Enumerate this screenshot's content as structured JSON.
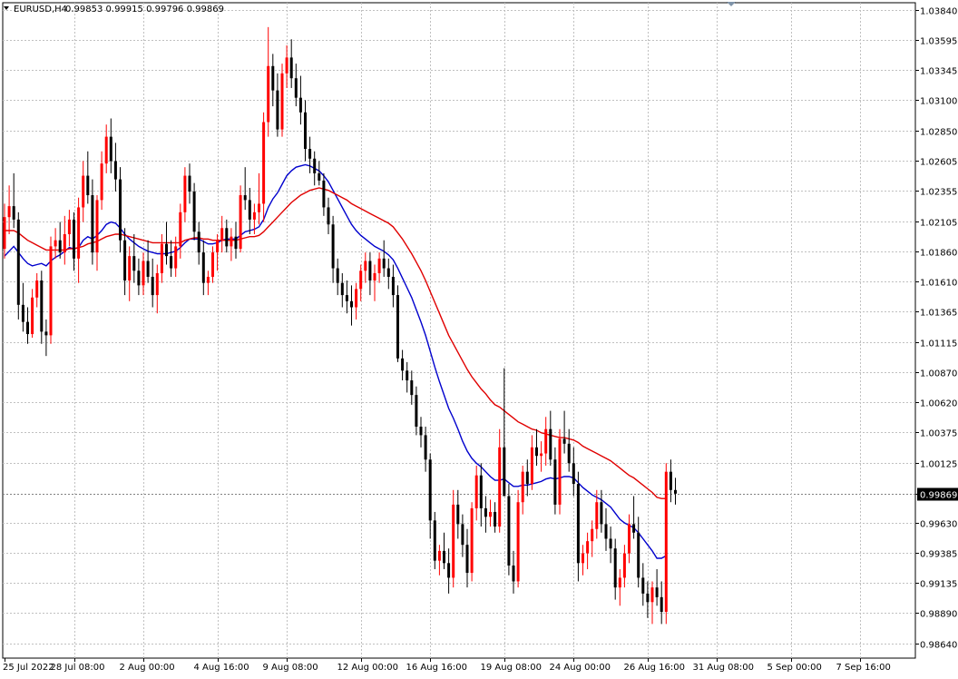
{
  "header": {
    "symbol_tf": "EURUSD,H4",
    "ohlc": "0.99853 0.99915 0.99796 0.99869"
  },
  "colors": {
    "background": "#ffffff",
    "grid": "#c0c0c0",
    "bull": "#ff0000",
    "bear": "#000000",
    "ma_fast": "#0000cd",
    "ma_slow": "#e00000",
    "price_tag_bg": "#000000",
    "price_tag_text": "#ffffff"
  },
  "chart_data": {
    "type": "candlestick",
    "title": "EURUSD,H4",
    "grid": true,
    "ylim": [
      0.9852,
      1.039
    ],
    "y_ticks": [
      "1.03840",
      "1.03595",
      "1.03345",
      "1.03100",
      "1.02850",
      "1.02605",
      "1.02355",
      "1.02105",
      "1.01860",
      "1.01610",
      "1.01365",
      "1.01115",
      "1.00870",
      "1.00620",
      "1.00375",
      "1.00125",
      "0.99869",
      "0.99630",
      "0.99385",
      "0.99135",
      "0.98890",
      "0.98640"
    ],
    "current_price": "0.99869",
    "x_labels": [
      {
        "label": "25 Jul 2022",
        "index": 0
      },
      {
        "label": "28 Jul 08:00",
        "index": 15
      },
      {
        "label": "2 Aug 00:00",
        "index": 30
      },
      {
        "label": "4 Aug 16:00",
        "index": 46
      },
      {
        "label": "9 Aug 08:00",
        "index": 61
      },
      {
        "label": "12 Aug 00:00",
        "index": 77
      },
      {
        "label": "16 Aug 16:00",
        "index": 92
      },
      {
        "label": "19 Aug 08:00",
        "index": 108
      },
      {
        "label": "24 Aug 00:00",
        "index": 123
      },
      {
        "label": "26 Aug 16:00",
        "index": 139
      },
      {
        "label": "31 Aug 08:00",
        "index": 154
      },
      {
        "label": "5 Sep 00:00",
        "index": 170
      },
      {
        "label": "7 Sep 16:00",
        "index": 185
      }
    ],
    "candles": [
      [
        1.0188,
        1.0225,
        1.018,
        1.0214
      ],
      [
        1.0214,
        1.024,
        1.02,
        1.0223
      ],
      [
        1.0223,
        1.025,
        1.0205,
        1.0212
      ],
      [
        1.0212,
        1.0218,
        1.013,
        1.0142
      ],
      [
        1.0142,
        1.016,
        1.012,
        1.0128
      ],
      [
        1.0128,
        1.014,
        1.011,
        1.0118
      ],
      [
        1.0118,
        1.0155,
        1.0115,
        1.0148
      ],
      [
        1.0148,
        1.0168,
        1.014,
        1.0162
      ],
      [
        1.0162,
        1.017,
        1.011,
        1.012
      ],
      [
        1.012,
        1.013,
        1.01,
        1.0117
      ],
      [
        1.0117,
        1.0198,
        1.011,
        1.019
      ],
      [
        1.019,
        1.0205,
        1.018,
        1.0195
      ],
      [
        1.0195,
        1.021,
        1.018,
        1.0185
      ],
      [
        1.0185,
        1.0215,
        1.0175,
        1.02
      ],
      [
        1.02,
        1.022,
        1.019,
        1.0212
      ],
      [
        1.0212,
        1.0218,
        1.017,
        1.018
      ],
      [
        1.018,
        1.023,
        1.016,
        1.0222
      ],
      [
        1.0222,
        1.026,
        1.021,
        1.0248
      ],
      [
        1.0248,
        1.0268,
        1.0225,
        1.0232
      ],
      [
        1.0232,
        1.0245,
        1.0175,
        1.0185
      ],
      [
        1.0185,
        1.0232,
        1.017,
        1.0228
      ],
      [
        1.0228,
        1.0268,
        1.022,
        1.0258
      ],
      [
        1.0258,
        1.029,
        1.025,
        1.028
      ],
      [
        1.028,
        1.0295,
        1.025,
        1.026
      ],
      [
        1.026,
        1.0275,
        1.0235,
        1.0245
      ],
      [
        1.0245,
        1.0255,
        1.0185,
        1.0195
      ],
      [
        1.0195,
        1.0205,
        1.015,
        1.0162
      ],
      [
        1.0162,
        1.019,
        1.0145,
        1.0182
      ],
      [
        1.0182,
        1.02,
        1.016,
        1.017
      ],
      [
        1.017,
        1.018,
        1.015,
        1.0158
      ],
      [
        1.0158,
        1.0185,
        1.015,
        1.0178
      ],
      [
        1.0178,
        1.0195,
        1.016,
        1.0165
      ],
      [
        1.0165,
        1.018,
        1.014,
        1.015
      ],
      [
        1.015,
        1.0175,
        1.0135,
        1.0168
      ],
      [
        1.0168,
        1.02,
        1.016,
        1.0192
      ],
      [
        1.0192,
        1.021,
        1.0175,
        1.0182
      ],
      [
        1.0182,
        1.0195,
        1.0165,
        1.0172
      ],
      [
        1.0172,
        1.0198,
        1.0165,
        1.019
      ],
      [
        1.019,
        1.0225,
        1.018,
        1.0218
      ],
      [
        1.0218,
        1.0255,
        1.021,
        1.0248
      ],
      [
        1.0248,
        1.0258,
        1.0225,
        1.0235
      ],
      [
        1.0235,
        1.0242,
        1.0195,
        1.0202
      ],
      [
        1.0202,
        1.021,
        1.0175,
        1.0185
      ],
      [
        1.0185,
        1.0195,
        1.015,
        1.016
      ],
      [
        1.016,
        1.017,
        1.015,
        1.0165
      ],
      [
        1.0165,
        1.019,
        1.016,
        1.0185
      ],
      [
        1.0185,
        1.02,
        1.017,
        1.0195
      ],
      [
        1.0195,
        1.0215,
        1.0185,
        1.0205
      ],
      [
        1.0205,
        1.0212,
        1.0185,
        1.019
      ],
      [
        1.019,
        1.0205,
        1.0178,
        1.0198
      ],
      [
        1.0198,
        1.021,
        1.018,
        1.0188
      ],
      [
        1.0188,
        1.024,
        1.0185,
        1.0232
      ],
      [
        1.0232,
        1.0255,
        1.022,
        1.0228
      ],
      [
        1.0228,
        1.0238,
        1.02,
        1.0212
      ],
      [
        1.0212,
        1.0225,
        1.02,
        1.0218
      ],
      [
        1.0218,
        1.025,
        1.0208,
        1.0225
      ],
      [
        1.0225,
        1.03,
        1.021,
        1.0292
      ],
      [
        1.0292,
        1.037,
        1.028,
        1.0338
      ],
      [
        1.0338,
        1.0348,
        1.0305,
        1.0318
      ],
      [
        1.0318,
        1.0332,
        1.028,
        1.0286
      ],
      [
        1.0286,
        1.034,
        1.028,
        1.0332
      ],
      [
        1.0332,
        1.0355,
        1.032,
        1.0345
      ],
      [
        1.0345,
        1.036,
        1.032,
        1.0328
      ],
      [
        1.0328,
        1.034,
        1.0305,
        1.0312
      ],
      [
        1.0312,
        1.033,
        1.029,
        1.03
      ],
      [
        1.03,
        1.031,
        1.026,
        1.027
      ],
      [
        1.027,
        1.028,
        1.025,
        1.0262
      ],
      [
        1.0262,
        1.0268,
        1.024,
        1.025
      ],
      [
        1.025,
        1.026,
        1.024,
        1.0244
      ],
      [
        1.0244,
        1.025,
        1.0215,
        1.0222
      ],
      [
        1.0222,
        1.023,
        1.02,
        1.0208
      ],
      [
        1.0208,
        1.0215,
        1.016,
        1.0172
      ],
      [
        1.0172,
        1.018,
        1.015,
        1.016
      ],
      [
        1.016,
        1.0168,
        1.014,
        1.015
      ],
      [
        1.015,
        1.0162,
        1.0135,
        1.0145
      ],
      [
        1.0145,
        1.0158,
        1.0125,
        1.014
      ],
      [
        1.014,
        1.016,
        1.013,
        1.0155
      ],
      [
        1.0155,
        1.0175,
        1.0145,
        1.017
      ],
      [
        1.017,
        1.0185,
        1.016,
        1.0178
      ],
      [
        1.0178,
        1.0185,
        1.015,
        1.0162
      ],
      [
        1.0162,
        1.0175,
        1.0145,
        1.0168
      ],
      [
        1.0168,
        1.0185,
        1.016,
        1.018
      ],
      [
        1.018,
        1.0195,
        1.0165,
        1.0172
      ],
      [
        1.0172,
        1.018,
        1.0155,
        1.0165
      ],
      [
        1.0165,
        1.0175,
        1.014,
        1.015
      ],
      [
        1.015,
        1.0158,
        1.0095,
        1.0098
      ],
      [
        1.0098,
        1.0105,
        1.008,
        1.0088
      ],
      [
        1.0088,
        1.0095,
        1.007,
        1.008
      ],
      [
        1.008,
        1.0088,
        1.006,
        1.0068
      ],
      [
        1.0068,
        1.0075,
        1.0035,
        1.0042
      ],
      [
        1.0042,
        1.005,
        1.0025,
        1.0035
      ],
      [
        1.0035,
        1.0042,
        1.0005,
        1.0015
      ],
      [
        1.0015,
        1.002,
        0.995,
        0.9965
      ],
      [
        0.9965,
        0.9972,
        0.9925,
        0.9932
      ],
      [
        0.9932,
        0.9945,
        0.992,
        0.994
      ],
      [
        0.994,
        0.9955,
        0.9925,
        0.993
      ],
      [
        0.993,
        0.9942,
        0.9905,
        0.9918
      ],
      [
        0.9918,
        0.999,
        0.991,
        0.9978
      ],
      [
        0.9978,
        0.999,
        0.995,
        0.9962
      ],
      [
        0.9962,
        0.997,
        0.9935,
        0.9945
      ],
      [
        0.9945,
        0.9958,
        0.991,
        0.9922
      ],
      [
        0.9922,
        0.998,
        0.9915,
        0.9975
      ],
      [
        0.9975,
        1.001,
        0.9965,
        1.0002
      ],
      [
        1.0002,
        1.0012,
        0.996,
        0.9975
      ],
      [
        0.9975,
        0.9985,
        0.9955,
        0.9968
      ],
      [
        0.9968,
        0.9982,
        0.996,
        0.9972
      ],
      [
        0.9972,
        0.998,
        0.9955,
        0.996
      ],
      [
        0.996,
        1.004,
        0.9955,
        1.0025
      ],
      [
        1.0025,
        1.009,
        1.001,
        0.9985
      ],
      [
        0.9985,
        0.9995,
        0.992,
        0.9928
      ],
      [
        0.9928,
        0.994,
        0.9905,
        0.9915
      ],
      [
        0.9915,
        0.999,
        0.991,
        0.998
      ],
      [
        0.998,
        1.001,
        0.997,
        1.0005
      ],
      [
        1.0005,
        1.0015,
        0.9985,
        0.9995
      ],
      [
        0.9995,
        1.0035,
        0.999,
        1.0025
      ],
      [
        1.0025,
        1.004,
        1.001,
        1.0018
      ],
      [
        1.0018,
        1.003,
        1.0005,
        1.002
      ],
      [
        1.002,
        1.005,
        1.001,
        1.004
      ],
      [
        1.004,
        1.0055,
        1.001,
        1.0015
      ],
      [
        1.0015,
        1.0025,
        0.997,
        0.9978
      ],
      [
        0.9978,
        1.004,
        0.997,
        1.0032
      ],
      [
        1.0032,
        1.0055,
        1.002,
        1.0028
      ],
      [
        1.0028,
        1.004,
        1.0005,
        1.0012
      ],
      [
        1.0012,
        1.0025,
        0.9985,
        0.9995
      ],
      [
        0.9995,
        1.0005,
        0.9915,
        0.993
      ],
      [
        0.993,
        0.9945,
        0.992,
        0.9938
      ],
      [
        0.9938,
        0.9955,
        0.9925,
        0.9948
      ],
      [
        0.9948,
        0.9965,
        0.9935,
        0.9958
      ],
      [
        0.9958,
        0.999,
        0.995,
        0.998
      ],
      [
        0.998,
        0.999,
        0.9955,
        0.9962
      ],
      [
        0.9962,
        0.9975,
        0.994,
        0.995
      ],
      [
        0.995,
        0.996,
        0.993,
        0.9942
      ],
      [
        0.9942,
        0.995,
        0.99,
        0.991
      ],
      [
        0.991,
        0.9925,
        0.9895,
        0.9918
      ],
      [
        0.9918,
        0.9945,
        0.991,
        0.9938
      ],
      [
        0.9938,
        0.997,
        0.993,
        0.9962
      ],
      [
        0.9962,
        0.9985,
        0.995,
        0.9955
      ],
      [
        0.9955,
        0.9968,
        0.991,
        0.9918
      ],
      [
        0.9918,
        0.993,
        0.9895,
        0.9905
      ],
      [
        0.9905,
        0.9915,
        0.9885,
        0.9898
      ],
      [
        0.9898,
        0.9915,
        0.988,
        0.991
      ],
      [
        0.991,
        0.9925,
        0.9895,
        0.9902
      ],
      [
        0.9902,
        0.9915,
        0.988,
        0.989
      ],
      [
        0.989,
        1.0012,
        0.988,
        1.0005
      ],
      [
        1.0005,
        1.0015,
        0.998,
        0.999
      ],
      [
        0.999,
        1.0,
        0.9978,
        0.9987
      ]
    ],
    "series": [
      {
        "name": "",
        "color": "#0000cd",
        "values": [
          1.0182,
          1.0186,
          1.019,
          1.0185,
          1.018,
          1.0176,
          1.0174,
          1.0175,
          1.0176,
          1.0174,
          1.0178,
          1.0181,
          1.0183,
          1.0186,
          1.0189,
          1.0188,
          1.0189,
          1.0195,
          1.0198,
          1.0196,
          1.0199,
          1.0203,
          1.0208,
          1.021,
          1.0209,
          1.0205,
          1.02,
          1.0196,
          1.0193,
          1.019,
          1.0188,
          1.0186,
          1.0185,
          1.0184,
          1.0184,
          1.0184,
          1.0185,
          1.0186,
          1.0189,
          1.0193,
          1.0196,
          1.0196,
          1.0196,
          1.0194,
          1.0192,
          1.0192,
          1.0193,
          1.0195,
          1.0196,
          1.0196,
          1.0196,
          1.0199,
          1.0202,
          1.0203,
          1.0204,
          1.0206,
          1.0212,
          1.0222,
          1.0229,
          1.0234,
          1.0241,
          1.0248,
          1.0252,
          1.0255,
          1.0256,
          1.0257,
          1.0256,
          1.0254,
          1.0252,
          1.0248,
          1.0243,
          1.0236,
          1.0229,
          1.0222,
          1.0215,
          1.0208,
          1.0203,
          1.0199,
          1.0196,
          1.0193,
          1.019,
          1.0188,
          1.0186,
          1.0183,
          1.0179,
          1.0172,
          1.0164,
          1.0156,
          1.0148,
          1.0138,
          1.0128,
          1.0117,
          1.0104,
          1.0091,
          1.0079,
          1.0068,
          1.0057,
          1.0049,
          1.004,
          1.003,
          1.0022,
          1.0016,
          1.0012,
          1.0009,
          1.0005,
          1.0001,
          0.9998,
          0.9998,
          0.9999,
          0.9996,
          0.9993,
          0.9993,
          0.9994,
          0.9994,
          0.9995,
          0.9996,
          0.9997,
          0.9999,
          1.0,
          0.9999,
          1.0,
          1.0001,
          1.0001,
          1.0,
          0.9996,
          0.9992,
          0.9989,
          0.9986,
          0.9984,
          0.9982,
          0.9979,
          0.9976,
          0.9971,
          0.9966,
          0.9963,
          0.9961,
          0.9959,
          0.9955,
          0.995,
          0.9945,
          0.994,
          0.9934,
          0.9934,
          0.9936
        ]
      },
      {
        "name": "",
        "color": "#e00000",
        "values": [
          1.0203,
          1.0203,
          1.0203,
          1.0201,
          1.0198,
          1.0195,
          1.0193,
          1.0191,
          1.0189,
          1.0187,
          1.0187,
          1.0187,
          1.0187,
          1.0187,
          1.0188,
          1.0188,
          1.0189,
          1.019,
          1.0192,
          1.0193,
          1.0194,
          1.0196,
          1.0198,
          1.0199,
          1.02,
          1.02,
          1.0199,
          1.0198,
          1.0197,
          1.0196,
          1.0195,
          1.0194,
          1.0193,
          1.0193,
          1.0193,
          1.0193,
          1.0193,
          1.0193,
          1.0193,
          1.0195,
          1.0196,
          1.0197,
          1.0197,
          1.0196,
          1.0196,
          1.0195,
          1.0195,
          1.0195,
          1.0195,
          1.0195,
          1.0195,
          1.0196,
          1.0197,
          1.0198,
          1.0198,
          1.0199,
          1.0202,
          1.0206,
          1.021,
          1.0214,
          1.0218,
          1.0222,
          1.0226,
          1.0229,
          1.0232,
          1.0234,
          1.0236,
          1.0237,
          1.0238,
          1.0237,
          1.0236,
          1.0234,
          1.0232,
          1.023,
          1.0228,
          1.0225,
          1.0223,
          1.0221,
          1.0219,
          1.0217,
          1.0215,
          1.0213,
          1.0211,
          1.0209,
          1.0206,
          1.0201,
          1.0196,
          1.019,
          1.0184,
          1.0177,
          1.017,
          1.0162,
          1.0153,
          1.0144,
          1.0135,
          1.0126,
          1.0117,
          1.011,
          1.0103,
          1.0096,
          1.0089,
          1.0083,
          1.0078,
          1.0073,
          1.0069,
          1.0064,
          1.006,
          1.0058,
          1.0055,
          1.0052,
          1.0049,
          1.0046,
          1.0044,
          1.0042,
          1.004,
          1.0039,
          1.0037,
          1.0036,
          1.0035,
          1.0034,
          1.0033,
          1.0033,
          1.0032,
          1.0031,
          1.0029,
          1.0026,
          1.0024,
          1.0022,
          1.002,
          1.0018,
          1.0016,
          1.0014,
          1.0011,
          1.0008,
          1.0005,
          1.0002,
          1.0,
          0.9997,
          0.9994,
          0.9991,
          0.9988,
          0.9984,
          0.9983,
          0.9983
        ]
      }
    ]
  }
}
